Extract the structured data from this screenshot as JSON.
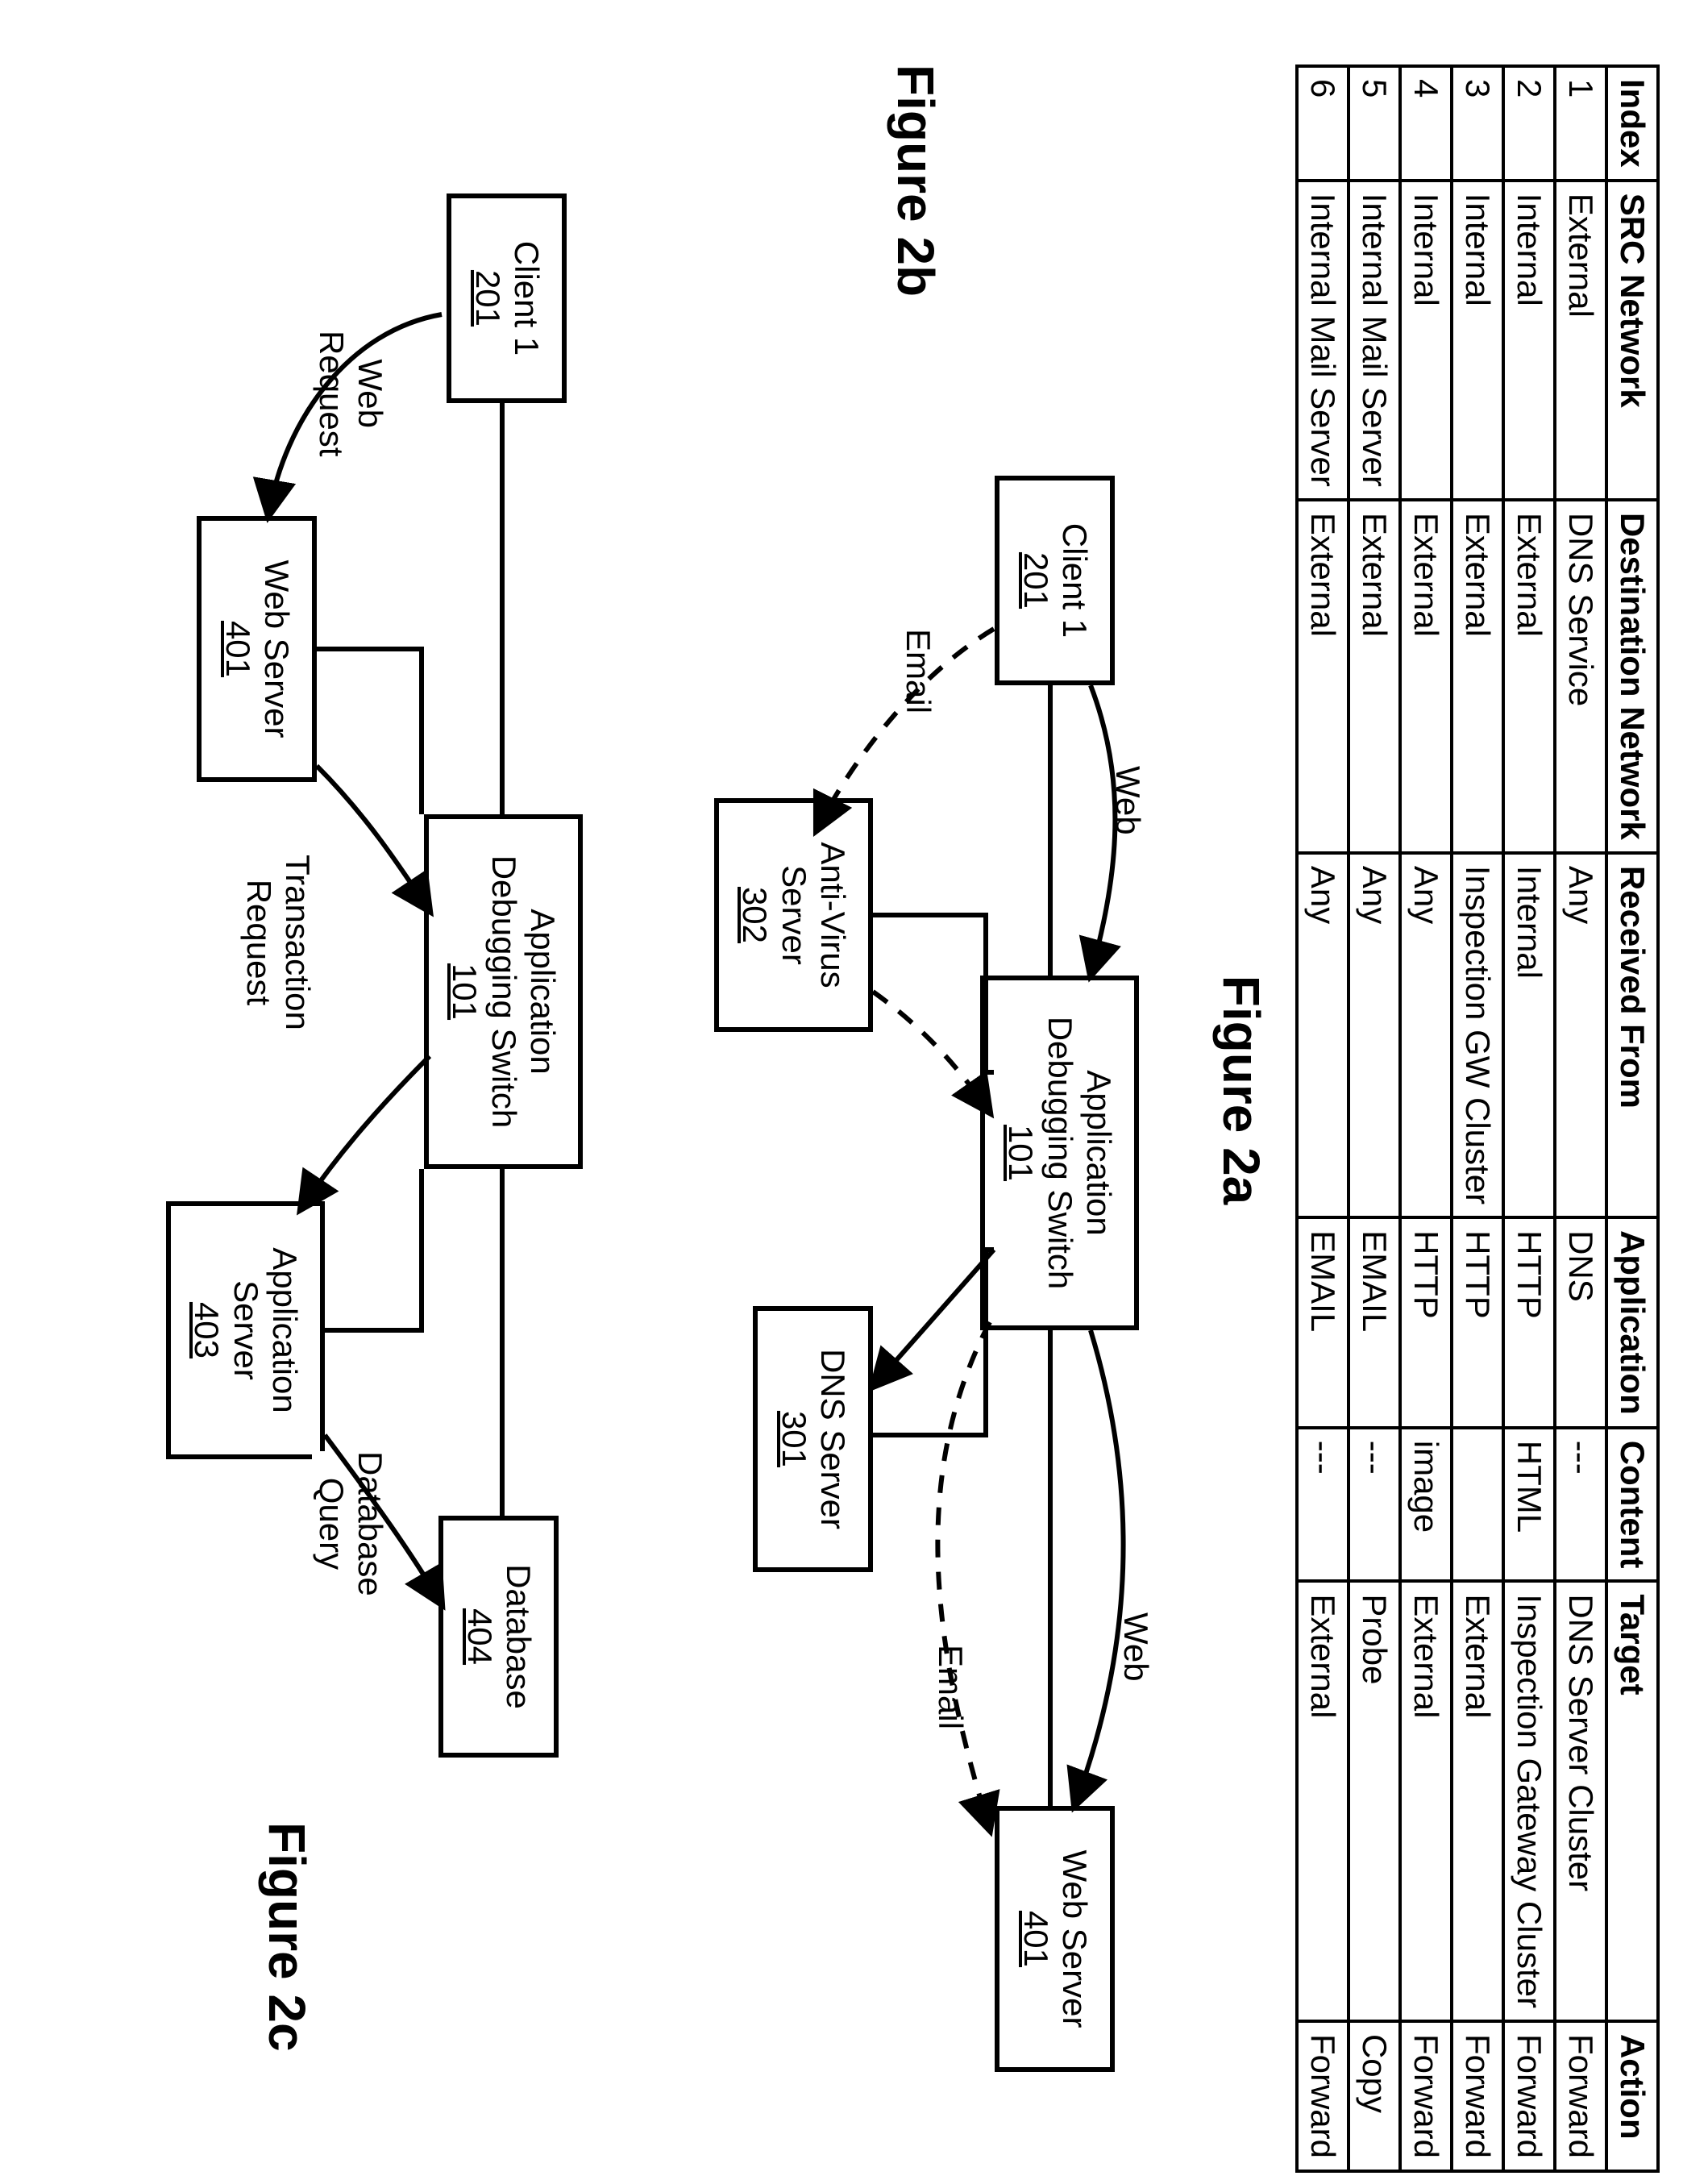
{
  "table": {
    "headers": [
      "Index",
      "SRC Network",
      "Destination Network",
      "Received From",
      "Application",
      "Content",
      "Target",
      "Action"
    ],
    "rows": [
      [
        "1",
        "External",
        "DNS Service",
        "Any",
        "DNS",
        "---",
        "DNS Server Cluster",
        "Forward"
      ],
      [
        "2",
        "Internal",
        "External",
        "Internal",
        "HTTP",
        "HTML",
        "Inspection Gateway Cluster",
        "Forward"
      ],
      [
        "3",
        "Internal",
        "External",
        "Inspection GW Cluster",
        "HTTP",
        "",
        "External",
        "Forward"
      ],
      [
        "4",
        "Internal",
        "External",
        "Any",
        "HTTP",
        "image",
        "External",
        "Forward"
      ],
      [
        "5",
        "Internal Mail Server",
        "External",
        "Any",
        "EMAIL",
        "---",
        "Probe",
        "Copy"
      ],
      [
        "6",
        "Internal Mail Server",
        "External",
        "Any",
        "EMAIL",
        "---",
        "External",
        "Forward"
      ]
    ]
  },
  "captions": {
    "a": "Figure 2a",
    "b": "Figure 2b",
    "c": "Figure 2c"
  },
  "figB": {
    "client": {
      "label": "Client 1",
      "ref": "201"
    },
    "switch": {
      "label": "Application\nDebugging Switch",
      "ref": "101"
    },
    "av": {
      "label": "Anti-Virus\nServer",
      "ref": "302"
    },
    "dns": {
      "label": "DNS Server",
      "ref": "301"
    },
    "web": {
      "label": "Web Server",
      "ref": "401"
    },
    "edge_web1": "Web",
    "edge_web2": "Web",
    "edge_email1": "Email",
    "edge_email2": "Email"
  },
  "figC": {
    "client": {
      "label": "Client 1",
      "ref": "201"
    },
    "webs": {
      "label": "Web Server",
      "ref": "401"
    },
    "switch": {
      "label": "Application\nDebugging Switch",
      "ref": "101"
    },
    "apps": {
      "label": "Application\nServer",
      "ref": "403"
    },
    "db": {
      "label": "Database",
      "ref": "404"
    },
    "edge_webreq": "Web\nRequest",
    "edge_trans": "Transaction\nRequest",
    "edge_dbq": "Database\nQuery"
  }
}
